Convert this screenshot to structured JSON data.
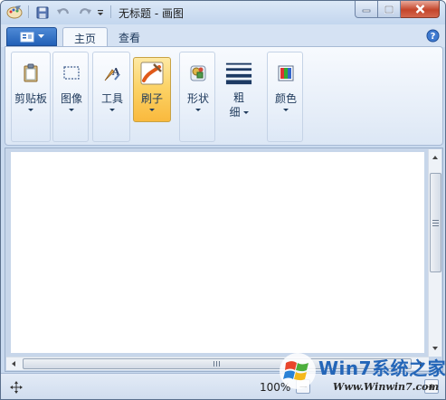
{
  "window": {
    "title": "无标题 - 画图"
  },
  "tabs": [
    {
      "label": "主页",
      "active": true
    },
    {
      "label": "查看",
      "active": false
    }
  ],
  "ribbon": {
    "clipboard": "剪贴板",
    "image": "图像",
    "tools": "工具",
    "brushes": "刷子",
    "shapes": "形状",
    "size_line1": "粗",
    "size_line2": "细",
    "colors": "颜色"
  },
  "status": {
    "zoom": "100%",
    "zoom_out": "−",
    "zoom_in": "+"
  },
  "watermark": {
    "title": "Win7系统之家",
    "url": "Www.Winwin7.com"
  },
  "colors": {
    "accent": "#2160b7",
    "selected_button": "#fcd468",
    "close_button": "#c4452a"
  },
  "icons": [
    "app-paint-icon",
    "save-icon",
    "undo-icon",
    "redo-icon",
    "customize-dropdown-icon",
    "app-menu-icon",
    "help-icon",
    "clipboard-icon",
    "select-icon",
    "tools-icon",
    "brush-icon",
    "shapes-icon",
    "line-size-icon",
    "colors-icon",
    "move-icon"
  ]
}
